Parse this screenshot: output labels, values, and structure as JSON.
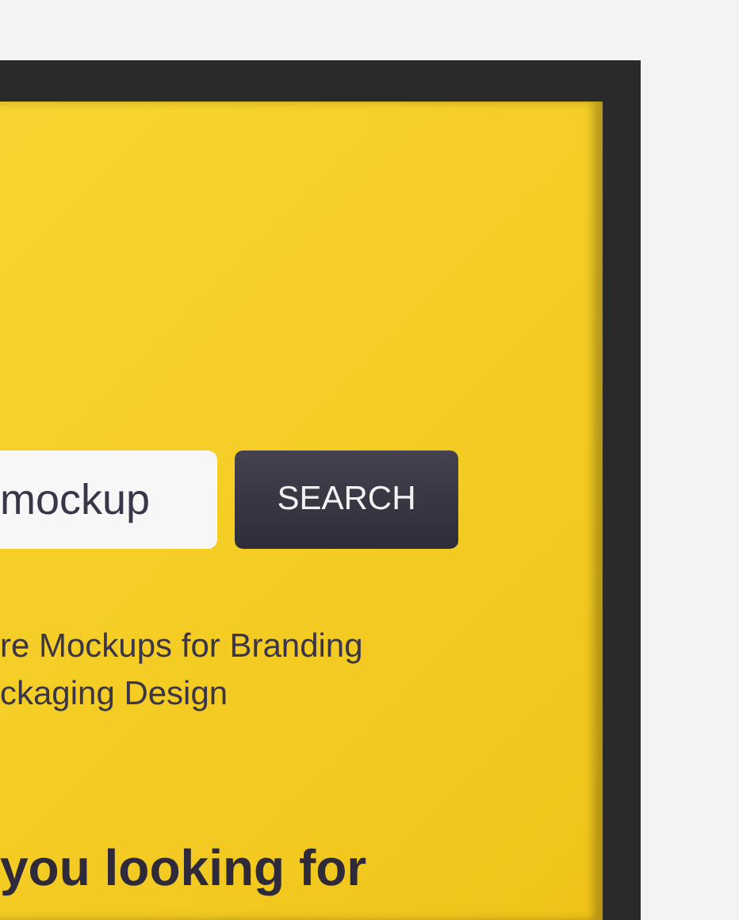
{
  "search": {
    "value": "mockup",
    "button": "SEARCH"
  },
  "subtitle": "re Mockups for Branding\nckaging Design",
  "heading": "you looking for"
}
